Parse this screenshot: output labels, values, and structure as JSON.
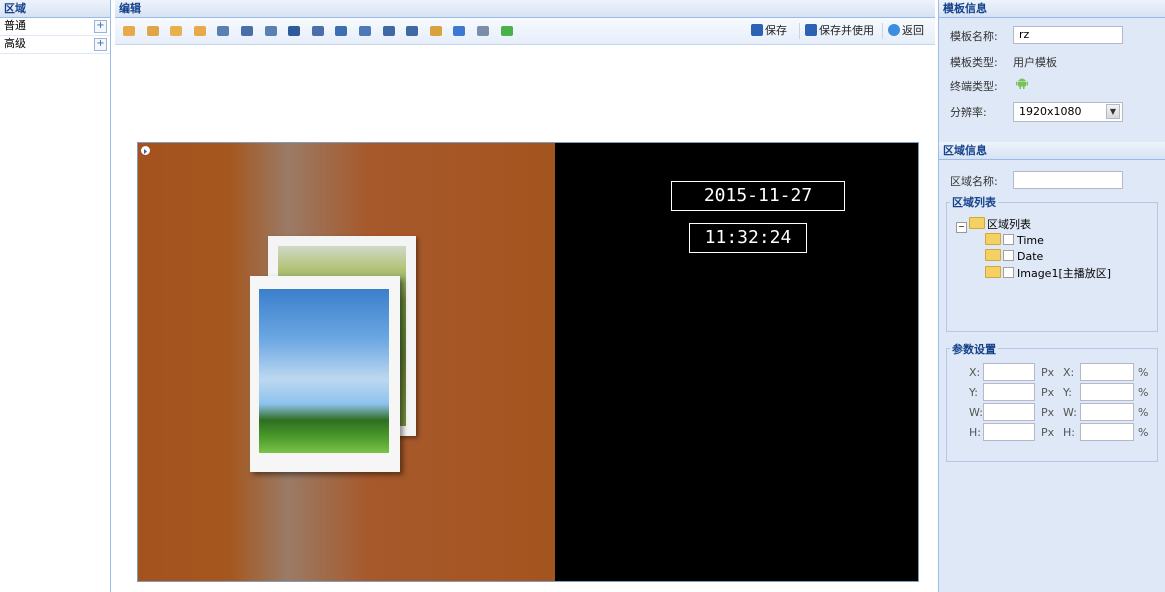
{
  "left": {
    "header": "区域",
    "items": [
      {
        "label": "普通",
        "expand": "+"
      },
      {
        "label": "高级",
        "expand": "+"
      }
    ]
  },
  "center": {
    "header": "编辑",
    "toolbar_icons": [
      "layer-up-icon",
      "layer-top-icon",
      "layer-down-icon",
      "layer-bottom-icon",
      "align-left-icon",
      "align-center-icon",
      "align-right-icon",
      "align-top-icon",
      "align-middle-icon",
      "align-bottom-icon",
      "distribute-h-icon",
      "distribute-v-icon",
      "same-width-icon",
      "same-height-icon",
      "fullscreen-icon",
      "delete-icon",
      "fit-icon"
    ],
    "save": "保存",
    "save_and_use": "保存并使用",
    "back": "返回",
    "canvas": {
      "date": "2015-11-27",
      "time": "11:32:24"
    }
  },
  "template_info": {
    "header": "模板信息",
    "name_label": "模板名称:",
    "name_value": "rz",
    "type_label": "模板类型:",
    "type_value": "用户模板",
    "terminal_label": "终端类型:",
    "terminal_icon": "android-icon",
    "resolution_label": "分辨率:",
    "resolution_value": "1920x1080"
  },
  "region_info": {
    "header": "区域信息",
    "name_label": "区域名称:",
    "name_value": "",
    "list_title": "区域列表",
    "tree_root": "区域列表",
    "tree_items": [
      "Time",
      "Date",
      "Image1[主播放区]"
    ]
  },
  "params": {
    "title": "参数设置",
    "rows": [
      {
        "label": "X:",
        "unit_px": "Px",
        "label2": "X:",
        "unit_pct": "%"
      },
      {
        "label": "Y:",
        "unit_px": "Px",
        "label2": "Y:",
        "unit_pct": "%"
      },
      {
        "label": "W:",
        "unit_px": "Px",
        "label2": "W:",
        "unit_pct": "%"
      },
      {
        "label": "H:",
        "unit_px": "Px",
        "label2": "H:",
        "unit_pct": "%"
      }
    ]
  },
  "colors": {
    "header_text": "#15428b",
    "panel_bg": "#dfe8f6",
    "zone_orange": "#a4521e"
  }
}
